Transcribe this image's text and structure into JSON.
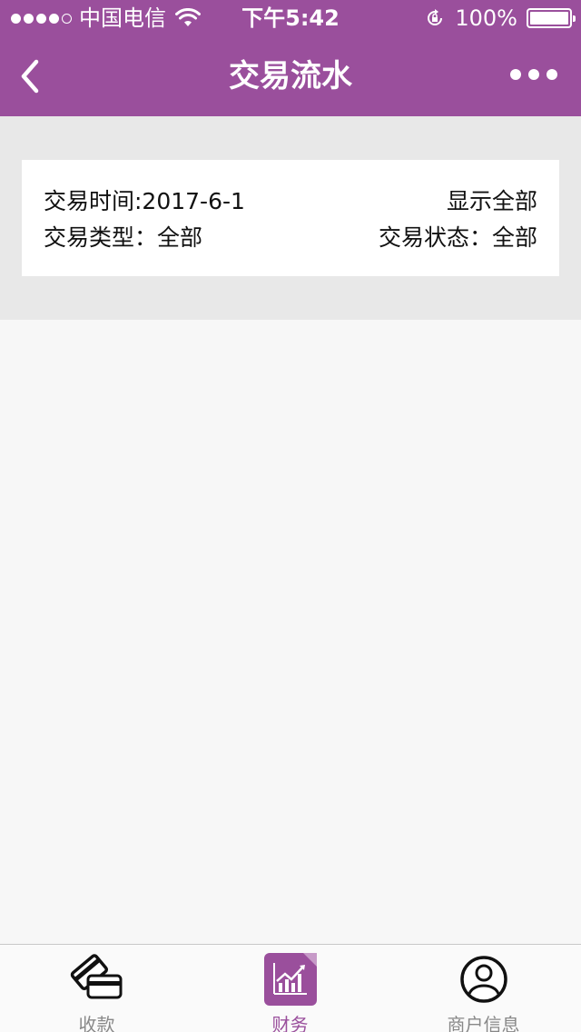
{
  "status_bar": {
    "carrier": "中国电信",
    "time": "下午5:42",
    "battery": "100%"
  },
  "nav": {
    "title": "交易流水"
  },
  "filter": {
    "time_label": "交易时间:2017-6-1",
    "show_all": "显示全部",
    "type_label": "交易类型：全部",
    "status_label": "交易状态：全部"
  },
  "tabs": [
    {
      "label": "收款",
      "icon": "card-payment-icon"
    },
    {
      "label": "财务",
      "icon": "finance-chart-icon",
      "active": true
    },
    {
      "label": "商户信息",
      "icon": "user-profile-icon"
    }
  ],
  "colors": {
    "brand": "#9a4f9c"
  }
}
